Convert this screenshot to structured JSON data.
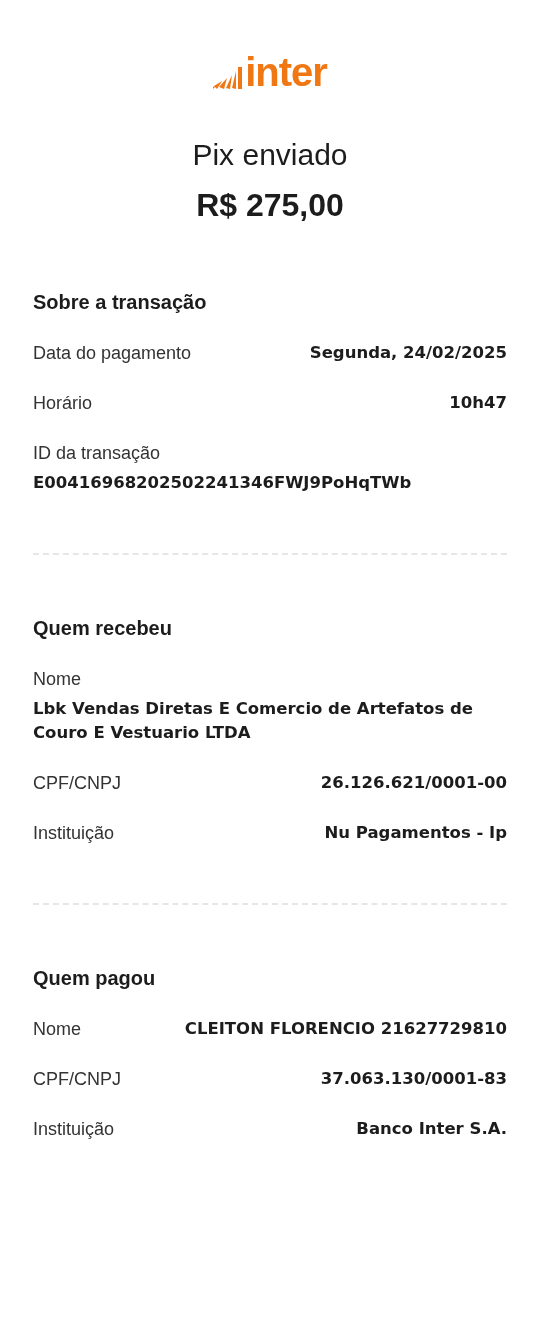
{
  "logo": {
    "text": "inter"
  },
  "header": {
    "title": "Pix enviado",
    "amount": "R$ 275,00"
  },
  "sections": [
    {
      "title": "Sobre a transação",
      "rows": [
        {
          "kind": "inline",
          "label": "Data do pagamento",
          "value": "Segunda, 24/02/2025"
        },
        {
          "kind": "inline",
          "label": "Horário",
          "value": "10h47"
        },
        {
          "kind": "stacked",
          "label": "ID da transação",
          "value": "E00416968202502241346FWJ9PoHqTWb"
        }
      ]
    },
    {
      "title": "Quem recebeu",
      "rows": [
        {
          "kind": "stacked",
          "label": "Nome",
          "value": "Lbk Vendas Diretas E Comercio de Artefatos de Couro E Vestuario LTDA"
        },
        {
          "kind": "inline",
          "label": "CPF/CNPJ",
          "value": "26.126.621/0001-00"
        },
        {
          "kind": "inline",
          "label": "Instituição",
          "value": "Nu Pagamentos - Ip"
        }
      ]
    },
    {
      "title": "Quem pagou",
      "rows": [
        {
          "kind": "inline",
          "label": "Nome",
          "value": "CLEITON FLORENCIO 21627729810"
        },
        {
          "kind": "inline",
          "label": "CPF/CNPJ",
          "value": "37.063.130/0001-83"
        },
        {
          "kind": "inline",
          "label": "Instituição",
          "value": "Banco Inter S.A."
        }
      ]
    }
  ]
}
